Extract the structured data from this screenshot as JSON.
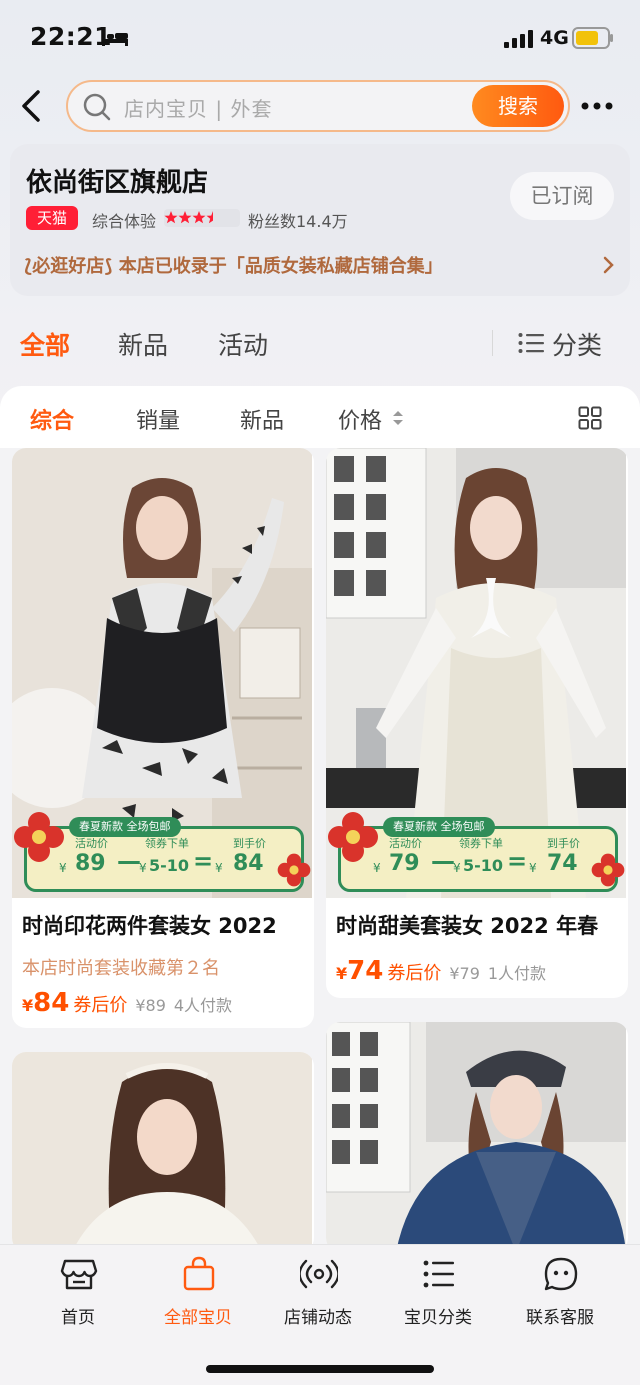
{
  "status_bar": {
    "time": "22:21",
    "network": "4G"
  },
  "search": {
    "placeholder": "店内宝贝 | 外套",
    "button_label": "搜索"
  },
  "shop": {
    "name": "依尚街区旗舰店",
    "badge": "天猫",
    "experience_label": "综合体验",
    "rating_stars": 3.5,
    "fans": "粉丝数14.4万",
    "subscribe_label": "已订阅",
    "recommend_prefix": "⟅必逛好店⟆",
    "recommend_text": "本店已收录于「品质女装私藏店铺合集」"
  },
  "main_tabs": [
    {
      "label": "全部",
      "active": true
    },
    {
      "label": "新品",
      "active": false
    },
    {
      "label": "活动",
      "active": false
    }
  ],
  "category_label": "分类",
  "sort_bar": [
    {
      "label": "综合",
      "active": true
    },
    {
      "label": "销量",
      "active": false
    },
    {
      "label": "新品",
      "active": false
    },
    {
      "label": "价格",
      "active": false
    }
  ],
  "products": [
    {
      "title": "时尚印花两件套装女 2022",
      "subtitle": "本店时尚套装收藏第２名",
      "price": "84",
      "price_tag": "券后价",
      "original": "¥89",
      "payers": "4人付款",
      "promo": {
        "tag": "春夏新款 全场包邮",
        "activity_label": "活动价",
        "activity_price": "89",
        "coupon_label": "领券下单",
        "coupon_value": "5-10",
        "final_label": "到手价",
        "final_price": "84",
        "yen": "¥",
        "minus": "—",
        "equals": "="
      }
    },
    {
      "title": "时尚甜美套装女 2022 年春",
      "subtitle": "",
      "price": "74",
      "price_tag": "券后价",
      "original": "¥79",
      "payers": "1人付款",
      "promo": {
        "tag": "春夏新款 全场包邮",
        "activity_label": "活动价",
        "activity_price": "79",
        "coupon_label": "领券下单",
        "coupon_value": "5-10",
        "final_label": "到手价",
        "final_price": "74",
        "yen": "¥",
        "minus": "—",
        "equals": "="
      }
    }
  ],
  "price_yen": "¥",
  "bottom_nav": [
    {
      "label": "首页",
      "icon": "shop-icon",
      "active": false
    },
    {
      "label": "全部宝贝",
      "icon": "bag-icon",
      "active": true
    },
    {
      "label": "店铺动态",
      "icon": "broadcast-icon",
      "active": false
    },
    {
      "label": "宝贝分类",
      "icon": "list-icon",
      "active": false
    },
    {
      "label": "联系客服",
      "icon": "chat-icon",
      "active": false
    }
  ],
  "colors": {
    "accent": "#ff5a10",
    "price": "#ff5000",
    "promo_green": "#2f8d58",
    "tmall_red": "#ff1f36"
  }
}
